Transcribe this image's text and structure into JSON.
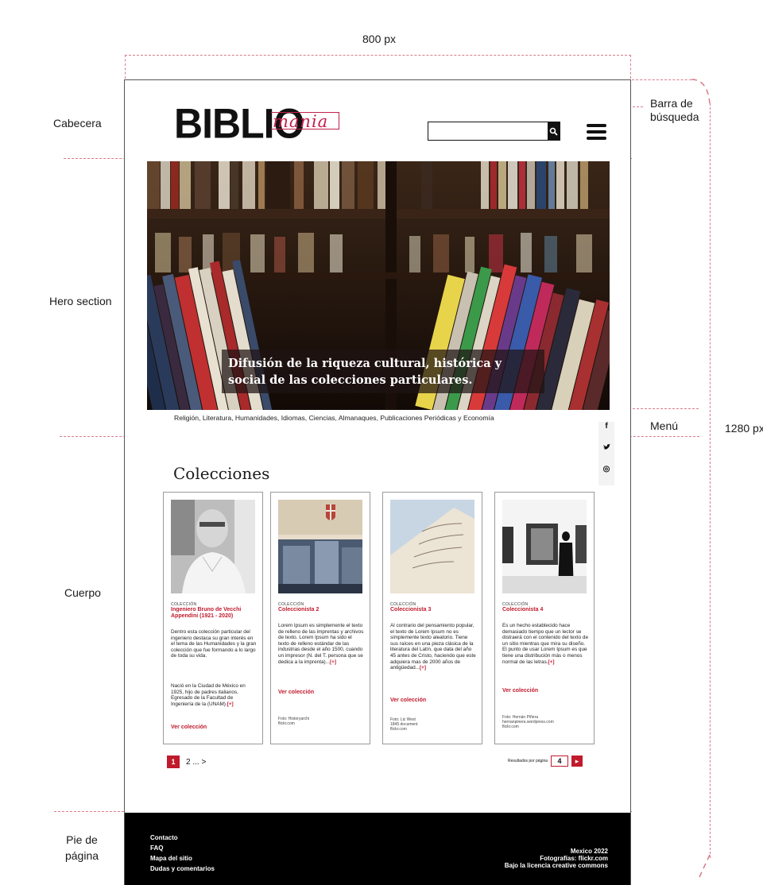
{
  "annotations": {
    "width": "800 px",
    "height": "1280 px",
    "header": "Cabecera",
    "search_bar": "Barra de\nbúsqueda",
    "hero": "Hero section",
    "menu": "Menú",
    "body": "Cuerpo",
    "footer": "Pie de\npágina"
  },
  "header": {
    "logo_main": "BIBLIO",
    "logo_sub": "mania",
    "search_placeholder": ""
  },
  "hero": {
    "caption": "Difusión de  la riqueza cultural, histórica y social de las colecciones particulares."
  },
  "menu_bar": {
    "categories": "Religión, Literatura, Humanidades, Idiomas, Ciencias, Almanaques, Publicaciones Periódicas y Economía"
  },
  "social": {
    "items": [
      "f",
      "y",
      "◎"
    ]
  },
  "collections": {
    "title": "Colecciones",
    "cards": [
      {
        "kicker": "COLECCIÓN",
        "title": "Ingeniero Bruno de Vecchi Appendini (1921 - 2020)",
        "body_1": "Dentro esta colección particular del ingeniero destaca su gran interés en el tema de las Humanidades y la gran colección que fue formando a lo largo de toda su vida.",
        "body_2": "Nació en la Ciudad de México en 1925, hijo de padres italianos. Egresado de la Facultad de Ingeniería de la (UNAM).",
        "more": "[+]",
        "link": "Ver colección",
        "credit": ""
      },
      {
        "kicker": "COLECCIÓN",
        "title": "Coleccionista 2",
        "body_1": "Lorem Ipsum es simplemente el texto de relleno de las imprentas y archivos de texto. Lorem Ipsum ha sido el texto de relleno estándar de las industrias desde el año 1500, cuando un impresor (N. del T. persona que se dedica a la imprenta)...",
        "body_2": "",
        "more": "[+]",
        "link": "Ver colección",
        "credit": "Foto: Historyarchi\nflickr.com"
      },
      {
        "kicker": "COLECCIÓN",
        "title": "Coleccionista 3",
        "body_1": "Al contrario del pensamiento popular, el texto de Lorem Ipsum no es simplemente texto aleatorio. Tiene sus raíces en una pieza clásica de la literatura del Latín, que data del año 45 antes de Cristo, haciendo que este adquiera mas de 2000 años de antigüedad...",
        "body_2": "",
        "more": "[+]",
        "link": "Ver colección",
        "credit": "Foto: Liz West\n1845 document\nflickr.com"
      },
      {
        "kicker": "COLECCIÓN",
        "title": "Coleccionista 4",
        "body_1": "Es un hecho establecido hace demasiado tiempo que un lector se distraerá con el contenido del texto de un sitio mientras que mira su diseño. El punto de usar Lorem Ipsum es que tiene una distribución más o menos normal de las letras.",
        "body_2": "",
        "more": "[+]",
        "link": "Ver colección",
        "credit": "Foto: Hernán Piñera\nhernanpinera.wordpress.com\nflickr.com"
      }
    ],
    "pagination": {
      "current": "1",
      "rest": "2 ... >"
    },
    "per_page": {
      "label": "Resultados por página",
      "value": "4",
      "go": "▸"
    }
  },
  "footer": {
    "links": [
      "Contacto",
      "FAQ",
      "Mapa del sitio",
      "Dudas y comentarios"
    ],
    "year": "Mexico 2022",
    "photos": "Fotografías: flickr.com",
    "license": "Bajo la licencia creative commons"
  },
  "colors": {
    "accent": "#c01a2c",
    "logo_accent": "#c2204a",
    "guide": "#d97a8a",
    "footer_bg": "#000000"
  }
}
